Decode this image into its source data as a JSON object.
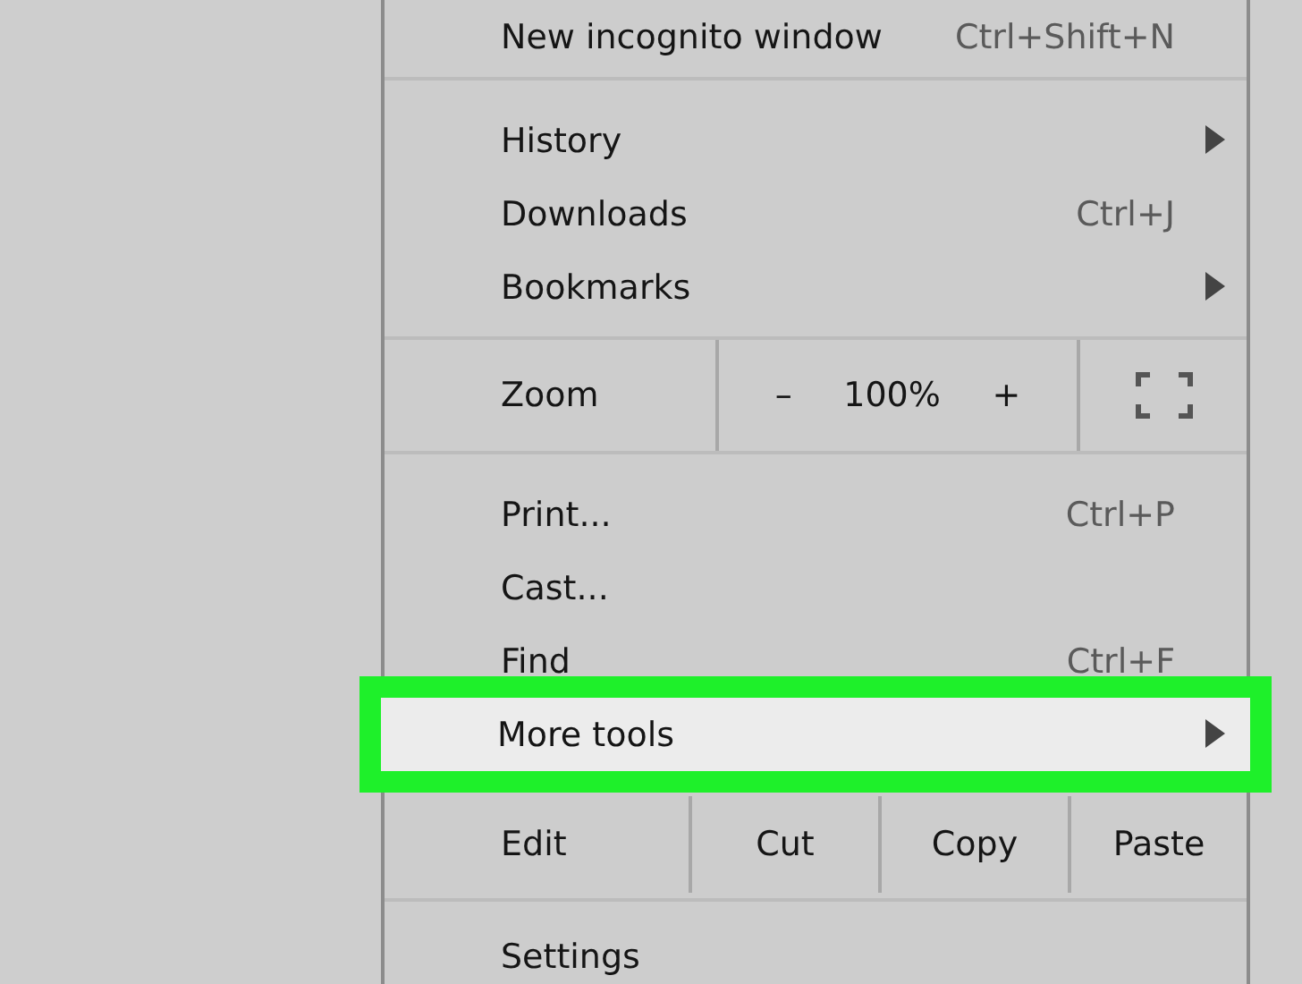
{
  "menu": {
    "sections": [
      [
        {
          "kind": "item",
          "label": "New incognito window",
          "shortcut": "Ctrl+Shift+N",
          "submenu": false,
          "highlighted": false
        }
      ],
      [
        {
          "kind": "item",
          "label": "History",
          "submenu": true,
          "highlighted": false
        },
        {
          "kind": "item",
          "label": "Downloads",
          "shortcut": "Ctrl+J",
          "submenu": false,
          "highlighted": false
        },
        {
          "kind": "item",
          "label": "Bookmarks",
          "submenu": true,
          "highlighted": false
        }
      ],
      [
        {
          "kind": "zoom",
          "label": "Zoom",
          "decrease": "–",
          "value": "100%",
          "increase": "+"
        }
      ],
      [
        {
          "kind": "item",
          "label": "Print...",
          "shortcut": "Ctrl+P",
          "submenu": false,
          "highlighted": false
        },
        {
          "kind": "item",
          "label": "Cast...",
          "submenu": false,
          "highlighted": false
        },
        {
          "kind": "item",
          "label": "Find",
          "shortcut": "Ctrl+F",
          "submenu": false,
          "highlighted": false
        },
        {
          "kind": "item",
          "label": "More tools",
          "submenu": true,
          "highlighted": true
        },
        {
          "kind": "edit",
          "label": "Edit",
          "actions": [
            "Cut",
            "Copy",
            "Paste"
          ]
        }
      ],
      [
        {
          "kind": "item",
          "label": "Settings",
          "submenu": false,
          "highlighted": false
        }
      ]
    ]
  }
}
